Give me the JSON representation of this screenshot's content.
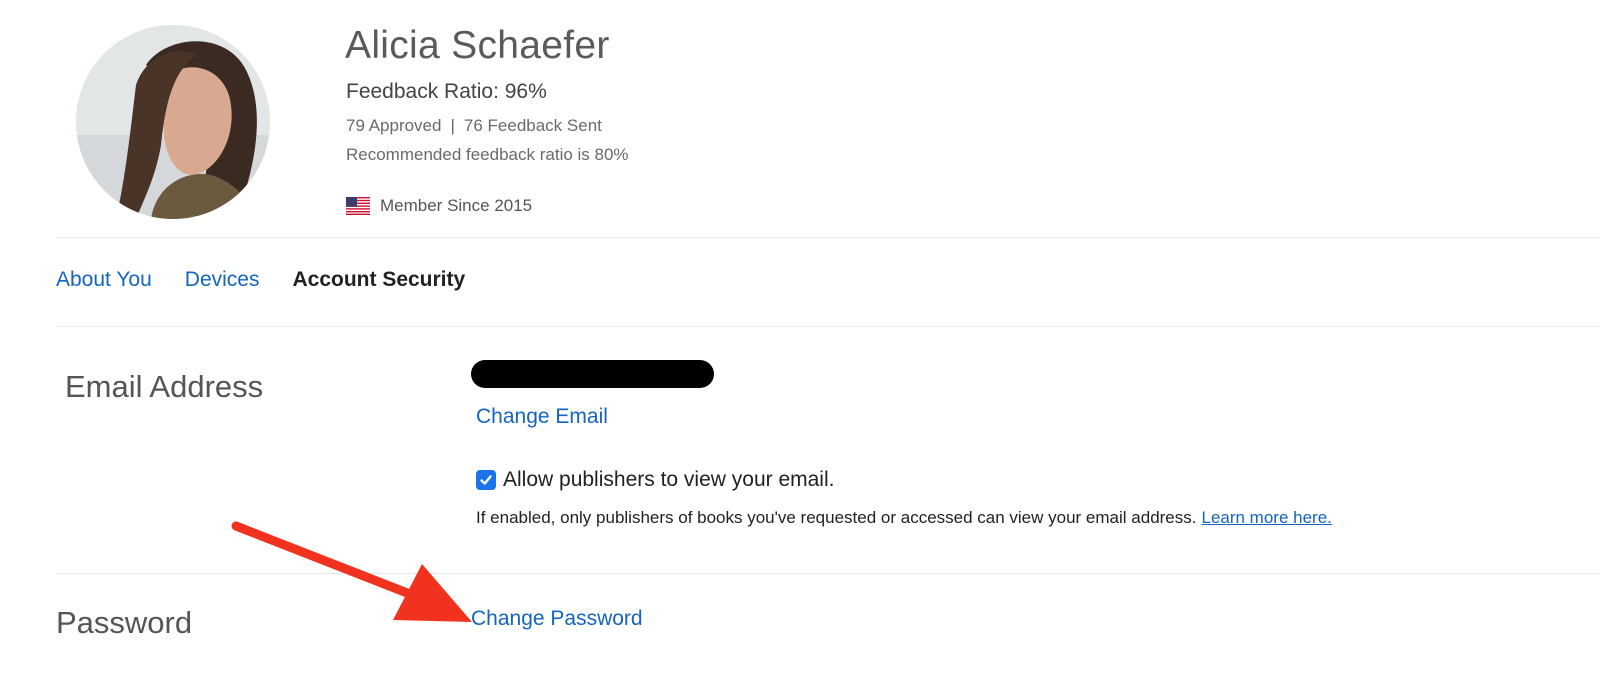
{
  "profile": {
    "name": "Alicia Schaefer",
    "feedback_ratio": "Feedback Ratio: 96%",
    "approved": "79 Approved",
    "separator": "|",
    "feedback_sent": "76 Feedback Sent",
    "recommended": "Recommended feedback ratio is 80%",
    "flag_icon": "us-flag-icon",
    "member_since": "Member Since 2015"
  },
  "tabs": [
    {
      "label": "About You",
      "active": false
    },
    {
      "label": "Devices",
      "active": false
    },
    {
      "label": "Account Security",
      "active": true
    }
  ],
  "email_section": {
    "label": "Email Address",
    "change_email": "Change Email",
    "allow_checked": true,
    "allow_label": "Allow publishers to view your email.",
    "info_text": "If enabled, only publishers of books you've requested or accessed can view your email address.",
    "learn_more": "Learn more here."
  },
  "password_section": {
    "label": "Password",
    "change_password": "Change Password"
  },
  "colors": {
    "link": "#1565c0",
    "checkbox": "#1a73e8",
    "annotation_arrow": "#f0321e"
  }
}
